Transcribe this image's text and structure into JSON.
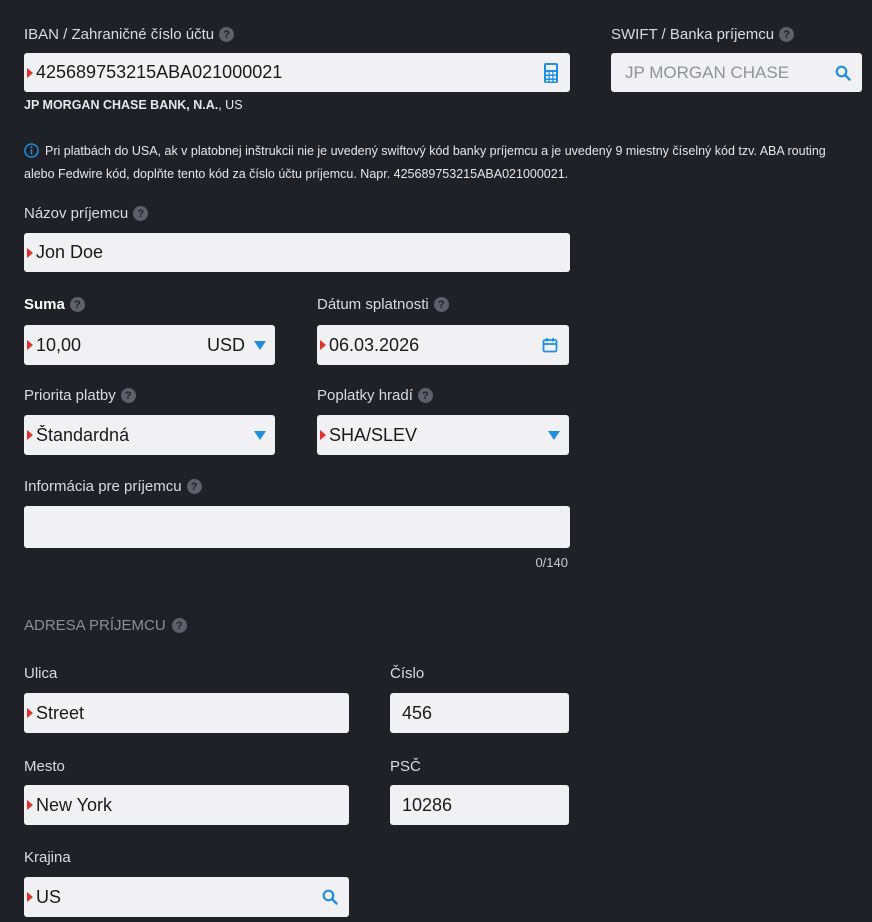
{
  "iban": {
    "label": "IBAN / Zahraničné číslo účtu",
    "value": "425689753215ABA021000021",
    "bank_name": "JP MORGAN CHASE BANK, N.A.",
    "bank_country": ", US"
  },
  "swift": {
    "label": "SWIFT / Banka príjemcu",
    "placeholder": "JP MORGAN CHASE"
  },
  "info_note": "Pri platbách do USA, ak v platobnej inštrukcii nie je uvedený swiftový kód banky príjemcu a je uvedený 9 miestny číselný kód tzv. ABA routing alebo Fedwire kód, doplňte tento kód za číslo účtu príjemcu. Napr. 425689753215ABA021000021.",
  "recipient_name": {
    "label": "Názov príjemcu",
    "value": "Jon Doe"
  },
  "amount": {
    "label": "Suma",
    "value": "10,00",
    "currency": "USD"
  },
  "due_date": {
    "label": "Dátum splatnosti",
    "value": "06.03.2026"
  },
  "priority": {
    "label": "Priorita platby",
    "value": "Štandardná"
  },
  "fees": {
    "label": "Poplatky hradí",
    "value": "SHA/SLEV"
  },
  "recipient_info": {
    "label": "Informácia pre príjemcu",
    "value": "",
    "counter": "0/140"
  },
  "address": {
    "section_title": "ADRESA PRÍJEMCU",
    "street": {
      "label": "Ulica",
      "value": "Street"
    },
    "number": {
      "label": "Číslo",
      "value": "456"
    },
    "city": {
      "label": "Mesto",
      "value": "New York"
    },
    "zip": {
      "label": "PSČ",
      "value": "10286"
    },
    "country": {
      "label": "Krajina",
      "value": "US"
    }
  },
  "help_glyph": "?",
  "colors": {
    "required": "#e0312b",
    "accent": "#1f8fe0",
    "background": "#1f2126",
    "field": "#f1f1f3"
  }
}
